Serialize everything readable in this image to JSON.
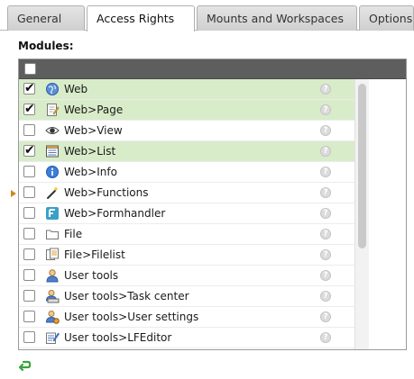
{
  "tabs": [
    {
      "label": "General",
      "active": false
    },
    {
      "label": "Access Rights",
      "active": true
    },
    {
      "label": "Mounts and Workspaces",
      "active": false
    },
    {
      "label": "Options",
      "active": false
    }
  ],
  "modules": {
    "label": "Modules:",
    "items": [
      {
        "label": "Web",
        "checked": true,
        "icon": "globe-icon"
      },
      {
        "label": "Web>Page",
        "checked": true,
        "icon": "page-edit-icon"
      },
      {
        "label": "Web>View",
        "checked": false,
        "icon": "eye-icon"
      },
      {
        "label": "Web>List",
        "checked": true,
        "icon": "list-icon"
      },
      {
        "label": "Web>Info",
        "checked": false,
        "icon": "info-icon"
      },
      {
        "label": "Web>Functions",
        "checked": false,
        "icon": "wand-icon"
      },
      {
        "label": "Web>Formhandler",
        "checked": false,
        "icon": "form-icon"
      },
      {
        "label": "File",
        "checked": false,
        "icon": "folder-icon"
      },
      {
        "label": "File>Filelist",
        "checked": false,
        "icon": "filelist-icon"
      },
      {
        "label": "User tools",
        "checked": false,
        "icon": "user-icon"
      },
      {
        "label": "User tools>Task center",
        "checked": false,
        "icon": "task-center-icon"
      },
      {
        "label": "User tools>User settings",
        "checked": false,
        "icon": "user-settings-icon"
      },
      {
        "label": "User tools>LFEditor",
        "checked": false,
        "icon": "lfeditor-icon"
      }
    ],
    "help_glyph": "?"
  },
  "colors": {
    "checked_row": "#d9ecc9",
    "header_bar": "#5e5e5e",
    "marker": "#d08a1a",
    "refresh": "#3aa33a"
  }
}
